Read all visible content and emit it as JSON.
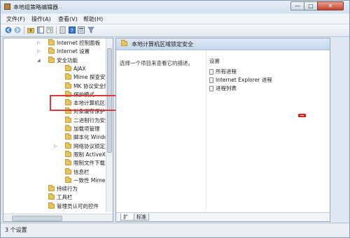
{
  "window": {
    "title": "本地组策略编辑器",
    "buttons": {
      "minimize": "—",
      "maximize": "□",
      "close": "✕"
    }
  },
  "menu": {
    "items": [
      "文件(F)",
      "操作(A)",
      "查看(V)",
      "帮助(H)"
    ]
  },
  "toolbar": {
    "icons": [
      "back-arrow-icon",
      "forward-arrow-icon",
      "up-folder-icon",
      "show-hide-tree-icon",
      "refresh-icon",
      "export-list-icon",
      "help-icon",
      "properties-icon",
      "filter-icon"
    ]
  },
  "tree": {
    "items": [
      {
        "label": "Internet 控制面板",
        "indent": 1,
        "expander": "▷"
      },
      {
        "label": "Internet 设置",
        "indent": 1,
        "expander": "▷"
      },
      {
        "label": "安全功能",
        "indent": 1,
        "expander": "◢"
      },
      {
        "label": "AJAX",
        "indent": 2,
        "expander": ""
      },
      {
        "label": "Mime 探查安全设置",
        "indent": 2,
        "expander": ""
      },
      {
        "label": "MK 协议安全限制",
        "indent": 2,
        "expander": ""
      },
      {
        "label": "保护模式",
        "indent": 2,
        "expander": ""
      },
      {
        "label": "本地计算机区域锁定安全",
        "indent": 2,
        "expander": ""
      },
      {
        "label": "对象缓存保护",
        "indent": 2,
        "expander": ""
      },
      {
        "label": "二进制行为安全限制",
        "indent": 2,
        "expander": ""
      },
      {
        "label": "加载项管理",
        "indent": 2,
        "expander": ""
      },
      {
        "label": "脚本化 Window 安全限制",
        "indent": 2,
        "expander": ""
      },
      {
        "label": "网络协议锁定",
        "indent": 2,
        "expander": "▷"
      },
      {
        "label": "限制 ActiveX 安装",
        "indent": 2,
        "expander": ""
      },
      {
        "label": "限制文件下载",
        "indent": 2,
        "expander": ""
      },
      {
        "label": "信息栏",
        "indent": 2,
        "expander": ""
      },
      {
        "label": "一致性 Mime 处理",
        "indent": 2,
        "expander": ""
      },
      {
        "label": "持续行为",
        "indent": 1,
        "expander": ""
      },
      {
        "label": "工具栏",
        "indent": 1,
        "expander": ""
      },
      {
        "label": "管理员认可的控件",
        "indent": 1,
        "expander": ""
      }
    ]
  },
  "details": {
    "header_title": "本地计算机区域锁定安全",
    "hint": "选择一个项目来查看它的描述。",
    "column_header": "设置",
    "items": [
      "所有进程",
      "Internet Explorer 进程",
      "进程列表"
    ],
    "tabs": [
      "扩展",
      "标准"
    ]
  },
  "status": {
    "text": "3 个设置"
  },
  "colors": {
    "highlight_box": "#d63a3a",
    "folder": "#e9c35c",
    "title_gradient_top": "#e6eef7",
    "close_button": "#c4442e"
  }
}
